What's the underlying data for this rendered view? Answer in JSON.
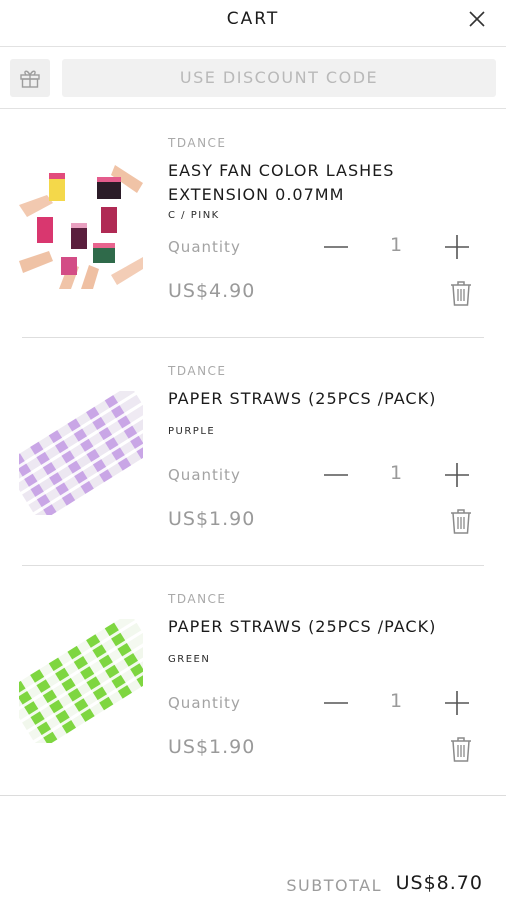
{
  "header": {
    "title": "CART",
    "close_icon": "close-icon"
  },
  "discount": {
    "gift_icon": "gift-icon",
    "button_label": "USE DISCOUNT CODE"
  },
  "items": [
    {
      "vendor": "TDANCE",
      "title": "EASY FAN COLOR LASHES EXTENSION 0.07MM",
      "variant": "C / PINK",
      "quantity_label": "Quantity",
      "quantity": "1",
      "price": "US$4.90"
    },
    {
      "vendor": "TDANCE",
      "title": "PAPER STRAWS (25PCS /PACK)",
      "variant": "PURPLE",
      "quantity_label": "Quantity",
      "quantity": "1",
      "price": "US$1.90"
    },
    {
      "vendor": "TDANCE",
      "title": "PAPER STRAWS (25PCS /PACK)",
      "variant": "GREEN",
      "quantity_label": "Quantity",
      "quantity": "1",
      "price": "US$1.90"
    }
  ],
  "summary": {
    "subtotal_label": "SUBTOTAL",
    "subtotal_value": "US$8.70"
  },
  "colors": {
    "text": "#1b1b1b",
    "muted": "#9a9a9a",
    "divider": "#dedede",
    "purple_stripe": "#c9a6e6",
    "green_stripe": "#7ed640"
  }
}
